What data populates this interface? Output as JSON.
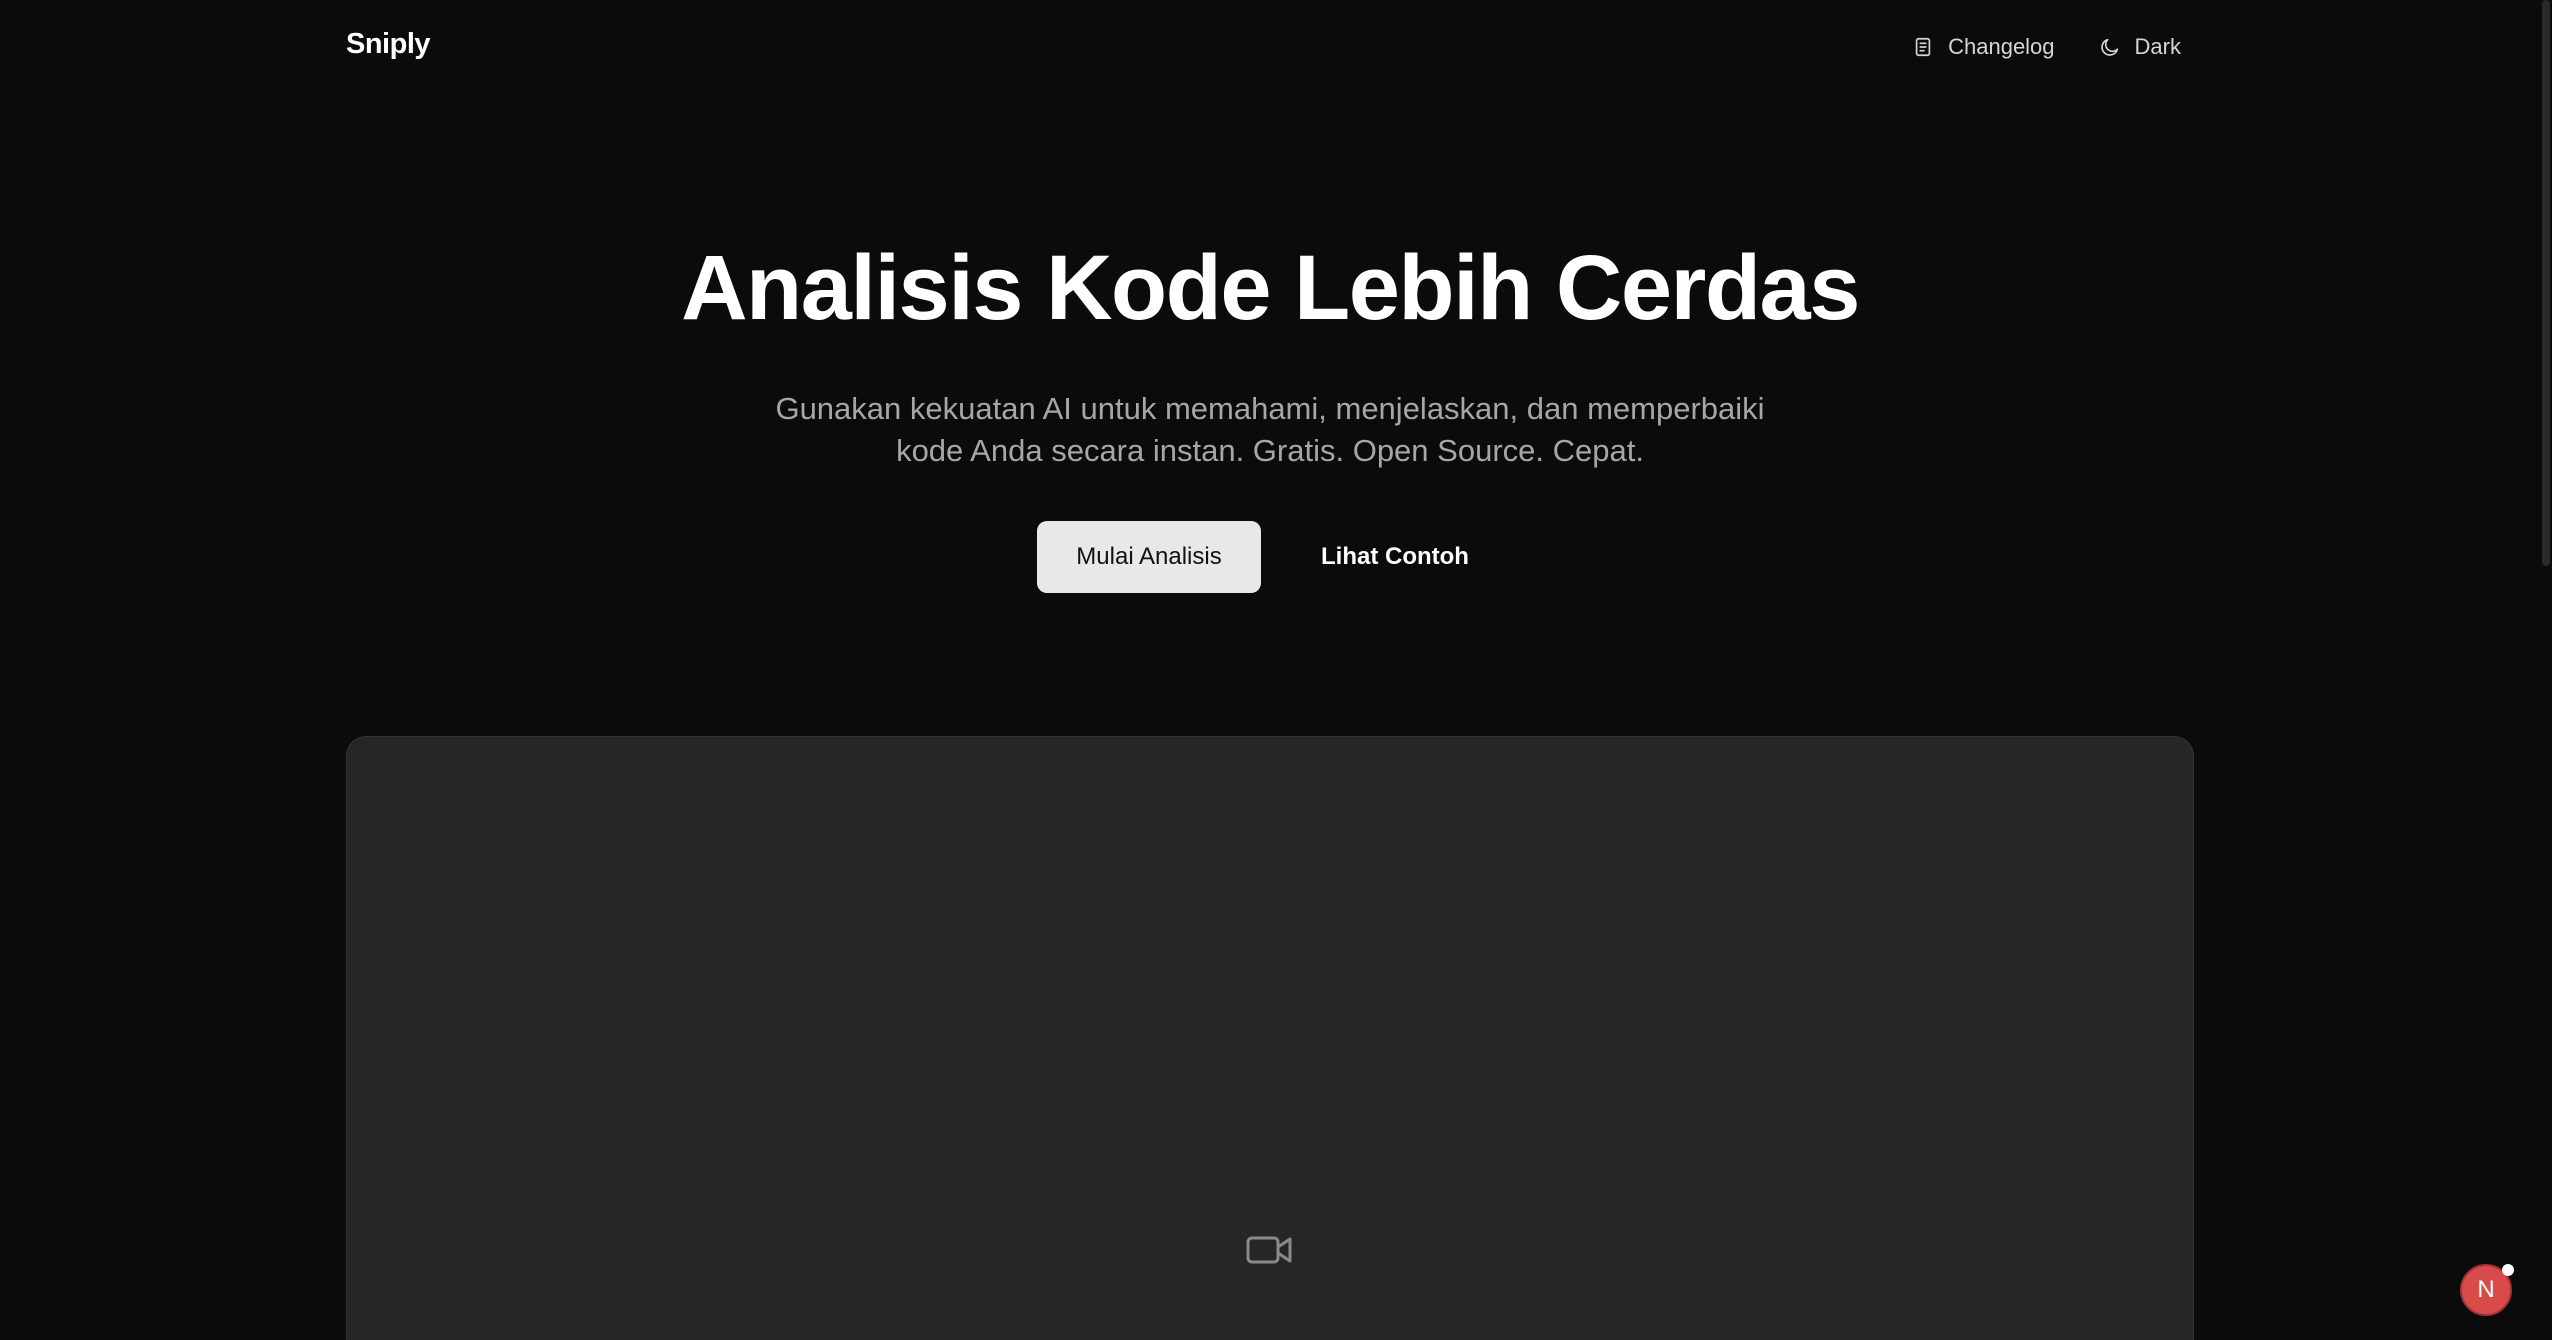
{
  "header": {
    "logo": "Sniply",
    "nav": [
      {
        "label": "Changelog",
        "icon": "document-icon"
      },
      {
        "label": "Dark",
        "icon": "moon-icon"
      }
    ]
  },
  "hero": {
    "title": "Analisis Kode Lebih Cerdas",
    "subtitle_line1": "Gunakan kekuatan AI untuk memahami, menjelaskan, dan memperbaiki",
    "subtitle_line2": "kode Anda secara instan. Gratis. Open Source. Cepat.",
    "primary_cta": "Mulai Analisis",
    "secondary_cta": "Lihat Contoh"
  },
  "media": {
    "icon": "video-camera-icon"
  },
  "floating": {
    "avatar_initial": "N",
    "avatar_color": "#d94b4b"
  },
  "colors": {
    "background": "#0b0b0b",
    "panel": "#262626",
    "subtitle": "#a6a6a6",
    "primary_button": "#e8e8e8"
  }
}
